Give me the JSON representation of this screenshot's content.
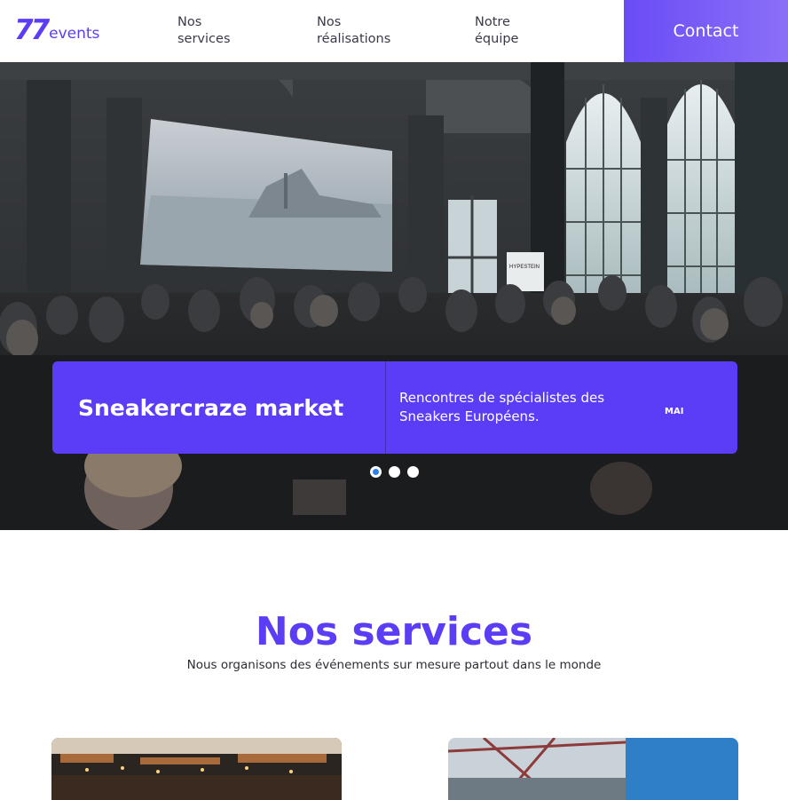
{
  "brand": {
    "logo_number": "77",
    "logo_word": "events",
    "accent": "#5b3df5"
  },
  "nav": {
    "items": [
      {
        "label": "Nos\nservices"
      },
      {
        "label": "Nos\nréalisations"
      },
      {
        "label": "Notre\néquipe"
      }
    ],
    "contact_label": "Contact"
  },
  "hero": {
    "event_title": "Sneakercraze market",
    "event_description": "Rencontres de spécialistes des Sneakers Européens.",
    "event_month": "MAI",
    "screen_sign": "HYPESTEIN",
    "slide_count": 3,
    "active_slide": 1
  },
  "services": {
    "title": "Nos services",
    "subtitle": "Nous organisons des événements sur mesure partout dans le monde"
  }
}
